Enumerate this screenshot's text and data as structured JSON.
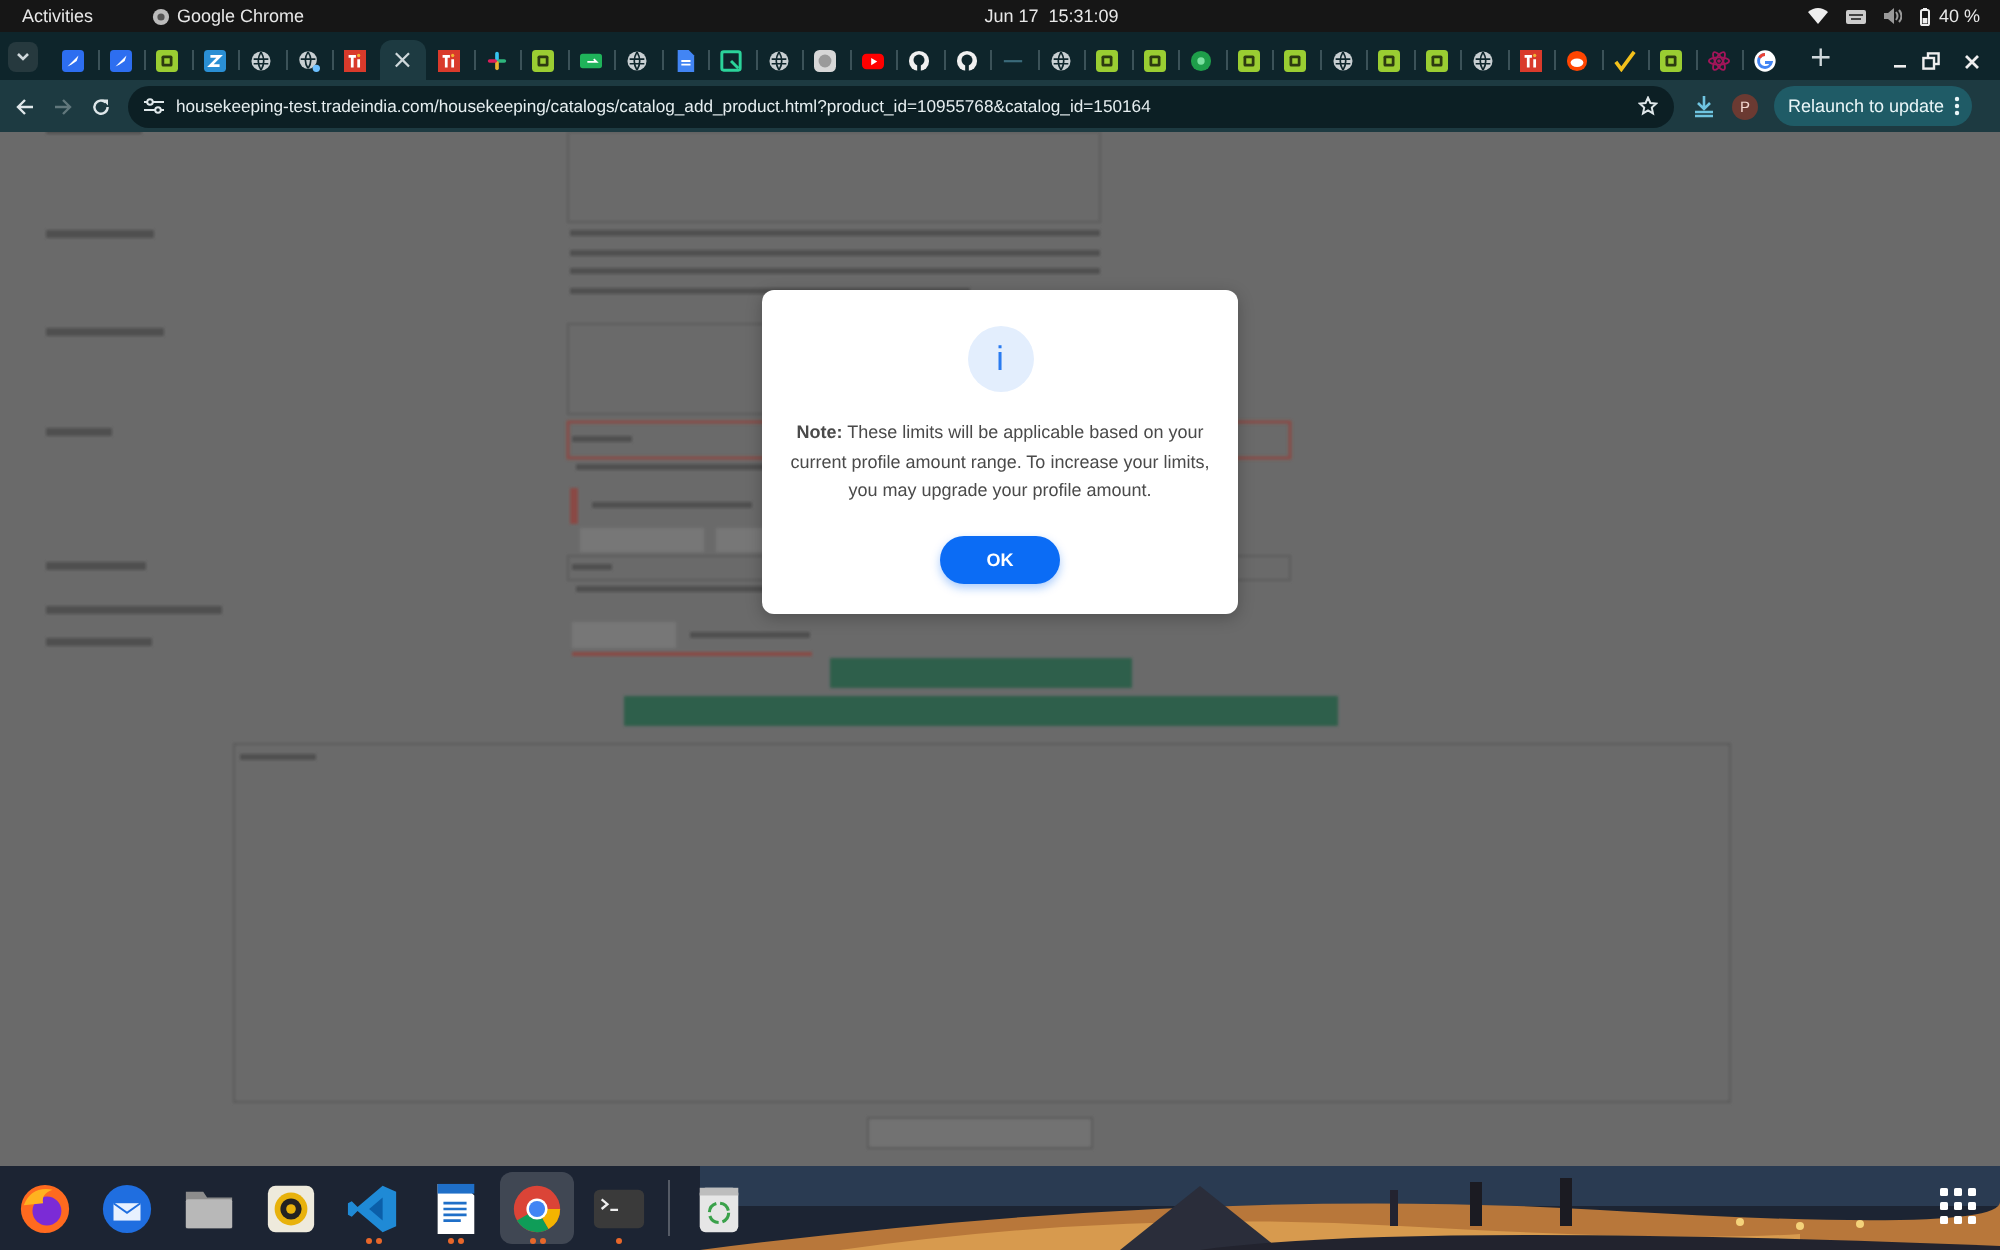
{
  "top_bar": {
    "activities": "Activities",
    "app_name": "Google Chrome",
    "date": "Jun 17",
    "time": "15:31:09",
    "battery": "40 %"
  },
  "tab_strip": {
    "close_glyph": "×",
    "new_tab": "+",
    "tabs": [
      {
        "kind": "feather",
        "selected": false
      },
      {
        "kind": "feather",
        "selected": false
      },
      {
        "kind": "lime",
        "selected": false
      },
      {
        "kind": "zigzag",
        "selected": false
      },
      {
        "kind": "globe",
        "selected": false
      },
      {
        "kind": "globe-badge",
        "selected": false
      },
      {
        "kind": "ti",
        "selected": false
      },
      {
        "selected": true
      },
      {
        "kind": "ti",
        "selected": false
      },
      {
        "kind": "pinwheel",
        "selected": false
      },
      {
        "kind": "lime",
        "selected": false
      },
      {
        "kind": "greenbar",
        "selected": false
      },
      {
        "kind": "globe",
        "selected": false
      },
      {
        "kind": "doc",
        "selected": false
      },
      {
        "kind": "frame",
        "selected": false
      },
      {
        "kind": "globe",
        "selected": false
      },
      {
        "kind": "graydot",
        "selected": false
      },
      {
        "kind": "play",
        "selected": false
      },
      {
        "kind": "cat",
        "selected": false
      },
      {
        "kind": "cat",
        "selected": false
      },
      {
        "kind": "dash",
        "selected": false
      },
      {
        "kind": "globe",
        "selected": false
      },
      {
        "kind": "lime",
        "selected": false
      },
      {
        "kind": "lime",
        "selected": false
      },
      {
        "kind": "greendot",
        "selected": false
      },
      {
        "kind": "lime",
        "selected": false
      },
      {
        "kind": "lime",
        "selected": false
      },
      {
        "kind": "globe",
        "selected": false
      },
      {
        "kind": "lime",
        "selected": false
      },
      {
        "kind": "lime",
        "selected": false
      },
      {
        "kind": "globe",
        "selected": false
      },
      {
        "kind": "ti",
        "selected": false
      },
      {
        "kind": "reddot",
        "selected": false
      },
      {
        "kind": "check",
        "selected": false
      },
      {
        "kind": "lime",
        "selected": false
      },
      {
        "kind": "atom",
        "selected": false
      },
      {
        "kind": "ring",
        "selected": false
      }
    ]
  },
  "toolbar": {
    "url": "housekeeping-test.tradeindia.com/housekeeping/catalogs/catalog_add_product.html?product_id=10955768&catalog_id=150164",
    "forward_disabled": true,
    "avatar": "P",
    "relaunch": "Relaunch to update"
  },
  "dialog": {
    "icon": "i",
    "message": "**Note:** These limits will be applicable based on your current profile amount range. To increase your limits, you may upgrade your profile amount.",
    "button": "OK"
  },
  "dock": {
    "apps": [
      {
        "kind": "firefox",
        "running": false,
        "focused": false
      },
      {
        "kind": "mail",
        "running": false,
        "focused": false
      },
      {
        "kind": "files",
        "running": false,
        "focused": false
      },
      {
        "kind": "music",
        "running": false,
        "focused": false
      },
      {
        "kind": "code",
        "running": true,
        "multiple_windows": true,
        "focused": false
      },
      {
        "kind": "writer",
        "running": true,
        "multiple_windows": true,
        "focused": false
      },
      {
        "kind": "chrome",
        "running": true,
        "multiple_windows": true,
        "focused": true
      },
      {
        "kind": "terminal",
        "running": true,
        "multiple_windows": false,
        "focused": false
      },
      {
        "kind": "trash",
        "running": false,
        "focused": false
      }
    ]
  }
}
